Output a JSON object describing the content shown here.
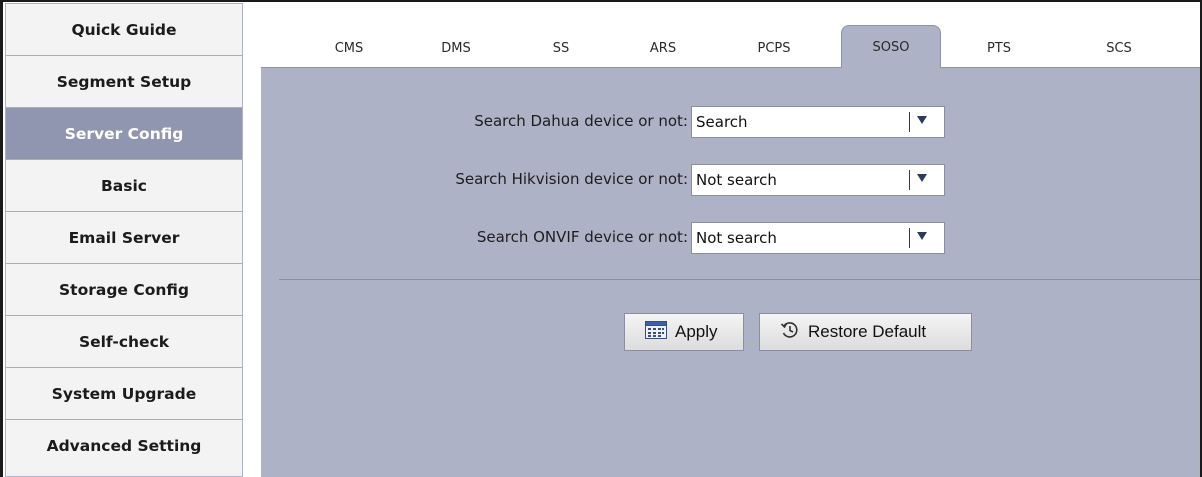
{
  "sidebar": {
    "items": [
      {
        "label": "Quick Guide",
        "active": false
      },
      {
        "label": "Segment Setup",
        "active": false
      },
      {
        "label": "Server Config",
        "active": true
      },
      {
        "label": "Basic",
        "active": false
      },
      {
        "label": "Email Server",
        "active": false
      },
      {
        "label": "Storage Config",
        "active": false
      },
      {
        "label": "Self-check",
        "active": false
      },
      {
        "label": "System Upgrade",
        "active": false
      },
      {
        "label": "Advanced Setting",
        "active": false
      }
    ]
  },
  "tabs": [
    {
      "label": "CMS",
      "active": false
    },
    {
      "label": "DMS",
      "active": false
    },
    {
      "label": "SS",
      "active": false
    },
    {
      "label": "ARS",
      "active": false
    },
    {
      "label": "PCPS",
      "active": false
    },
    {
      "label": "SOSO",
      "active": true
    },
    {
      "label": "PTS",
      "active": false
    },
    {
      "label": "SCS",
      "active": false
    }
  ],
  "form": {
    "dahua": {
      "label": "Search Dahua device or not:",
      "value": "Search"
    },
    "hikvision": {
      "label": "Search Hikvision device or not:",
      "value": "Not search"
    },
    "onvif": {
      "label": "Search ONVIF device or not:",
      "value": "Not search"
    }
  },
  "buttons": {
    "apply": "Apply",
    "restore": "Restore Default"
  },
  "colors": {
    "panel": "#aeb2c6",
    "active_sidebar": "#9196b0",
    "dropdown_arrow": "#2e3a5a"
  }
}
